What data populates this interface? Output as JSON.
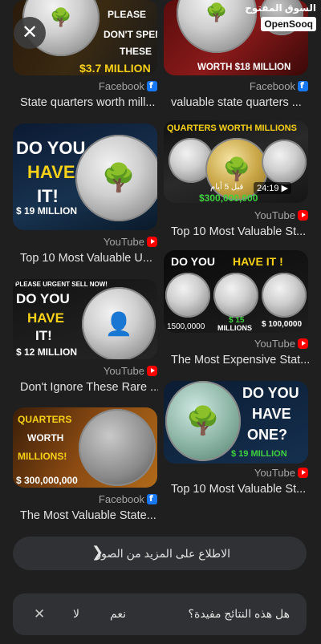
{
  "results": [
    {
      "source": "Facebook",
      "source_icon": "facebook-icon",
      "title": "State quarters worth mill...",
      "text": [
        "PLEASE",
        "DON'T SPEND",
        "THESE",
        "$3.7 MILLION"
      ]
    },
    {
      "source": "Facebook",
      "source_icon": "facebook-icon",
      "title": "valuable state quarters ...",
      "text": [
        "WORTH $18 MILLION"
      ]
    },
    {
      "source": "YouTube",
      "source_icon": "youtube-icon",
      "title": "Top 10 Most Valuable U...",
      "text": [
        "DO YOU",
        "HAVE",
        "IT!",
        "$ 19 MILLION"
      ]
    },
    {
      "source": "YouTube",
      "source_icon": "youtube-icon",
      "title": "Top 10 Most Valuable St...",
      "text": [
        "QUARTERS WORTH MILLIONS",
        "24:19",
        "قبل 5 أيام",
        "$300,000,000"
      ]
    },
    {
      "source": "YouTube",
      "source_icon": "youtube-icon",
      "title": "Don't Ignore These Rare ...",
      "text": [
        "PLEASE URGENT SELL NOW!",
        "DO YOU",
        "HAVE",
        "IT!",
        "$ 12 MILLION"
      ]
    },
    {
      "source": "YouTube",
      "source_icon": "youtube-icon",
      "title": "The Most Expensive Stat...",
      "text": [
        "DO YOU",
        "HAVE IT !",
        "1500,0000",
        "$ 15",
        "MILLIONS",
        "$ 100,0000"
      ]
    },
    {
      "source": "Facebook",
      "source_icon": "facebook-icon",
      "title": "The Most Valuable State...",
      "text": [
        "QUARTERS",
        "WORTH",
        "MILLIONS!",
        "$ 300,000,000"
      ]
    },
    {
      "source": "YouTube",
      "source_icon": "youtube-icon",
      "title": "Top 10 Most Valuable St...",
      "text": [
        "DO YOU",
        "HAVE",
        "ONE?",
        "$ 19 MILLION"
      ]
    }
  ],
  "overlay_logo": {
    "arabic": "السوق المفتوح",
    "latin": "OpenSooq"
  },
  "more_images_label": "الاطلاع على المزيد من الصور",
  "feedback": {
    "question": "هل هذه النتائج مفيدة؟",
    "yes": "نعم",
    "no": "لا"
  },
  "colors": {
    "background": "#1f1f1f",
    "panel": "#303134",
    "facebook": "#1877f2",
    "youtube": "#ff0000",
    "accent_yellow": "#f7d117",
    "accent_green": "#3fd13f"
  }
}
